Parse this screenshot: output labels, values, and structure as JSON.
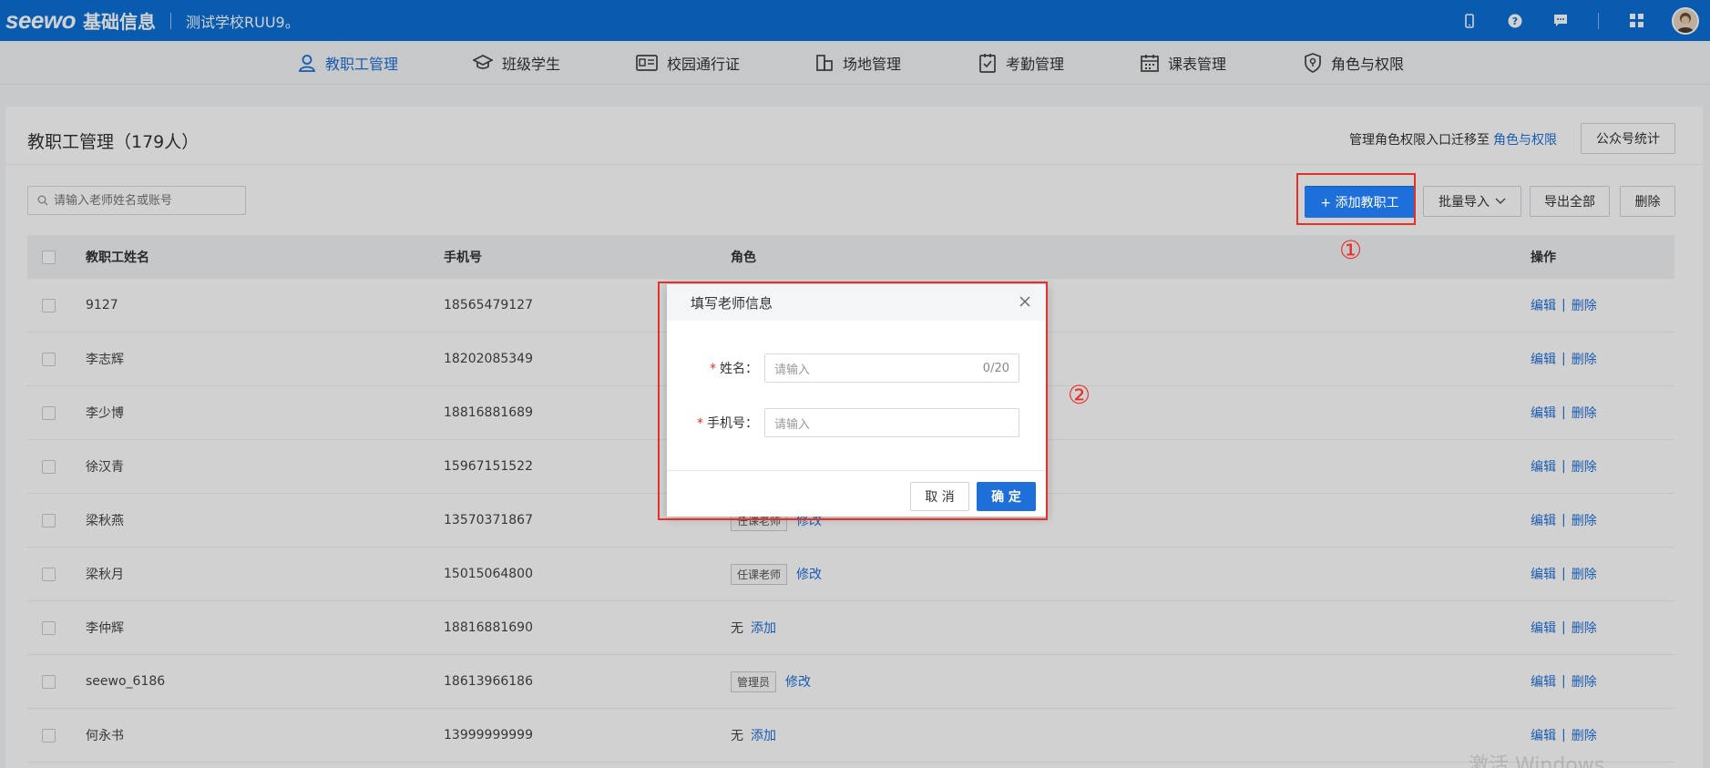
{
  "header": {
    "brand": "seewo",
    "product": "基础信息",
    "school": "测试学校RUU9。"
  },
  "nav": [
    {
      "label": "教职工管理",
      "icon": "user-icon",
      "active": true
    },
    {
      "label": "班级学生",
      "icon": "graduation-cap-icon",
      "active": false
    },
    {
      "label": "校园通行证",
      "icon": "id-card-icon",
      "active": false
    },
    {
      "label": "场地管理",
      "icon": "building-icon",
      "active": false
    },
    {
      "label": "考勤管理",
      "icon": "clipboard-check-icon",
      "active": false
    },
    {
      "label": "课表管理",
      "icon": "calendar-icon",
      "active": false
    },
    {
      "label": "角色与权限",
      "icon": "shield-icon",
      "active": false
    }
  ],
  "page": {
    "title": "教职工管理（179人）",
    "hint_text": "管理角色权限入口迁移至",
    "hint_link": "角色与权限",
    "wechat_stats": "公众号统计",
    "search_placeholder": "请输入老师姓名或账号",
    "add_button": "+ 添加教职工",
    "batch_import": "批量导入",
    "export_all": "导出全部",
    "delete": "删除"
  },
  "table": {
    "columns": [
      "教职工姓名",
      "手机号",
      "角色",
      "操作"
    ],
    "edit": "编辑",
    "remove": "删除",
    "rows": [
      {
        "name": "9127",
        "phone": "18565479127",
        "role": "",
        "role_action": ""
      },
      {
        "name": "李志辉",
        "phone": "18202085349",
        "role": "",
        "role_action": ""
      },
      {
        "name": "李少博",
        "phone": "18816881689",
        "role": "",
        "role_action": ""
      },
      {
        "name": "徐汉青",
        "phone": "15967151522",
        "role": "",
        "role_action": ""
      },
      {
        "name": "梁秋燕",
        "phone": "13570371867",
        "role": "任课老师",
        "role_action": "修改"
      },
      {
        "name": "梁秋月",
        "phone": "15015064800",
        "role": "任课老师",
        "role_action": "修改"
      },
      {
        "name": "李仲辉",
        "phone": "18816881690",
        "role": "无",
        "role_action": "添加"
      },
      {
        "name": "seewo_6186",
        "phone": "18613966186",
        "role": "管理员",
        "role_action": "修改"
      },
      {
        "name": "何永书",
        "phone": "13999999999",
        "role": "无",
        "role_action": "添加"
      }
    ]
  },
  "dialog": {
    "title": "填写老师信息",
    "name_label": "姓名：",
    "name_placeholder": "请输入",
    "name_count": "0/20",
    "phone_label": "手机号：",
    "phone_placeholder": "请输入",
    "cancel": "取 消",
    "ok": "确 定"
  },
  "annotations": {
    "step1": "①",
    "step2": "②"
  },
  "watermark": "激活 Windows",
  "colors": {
    "topbar": "#0c6fd6",
    "primary": "#1e6fd9",
    "annotation": "#e8302b"
  }
}
